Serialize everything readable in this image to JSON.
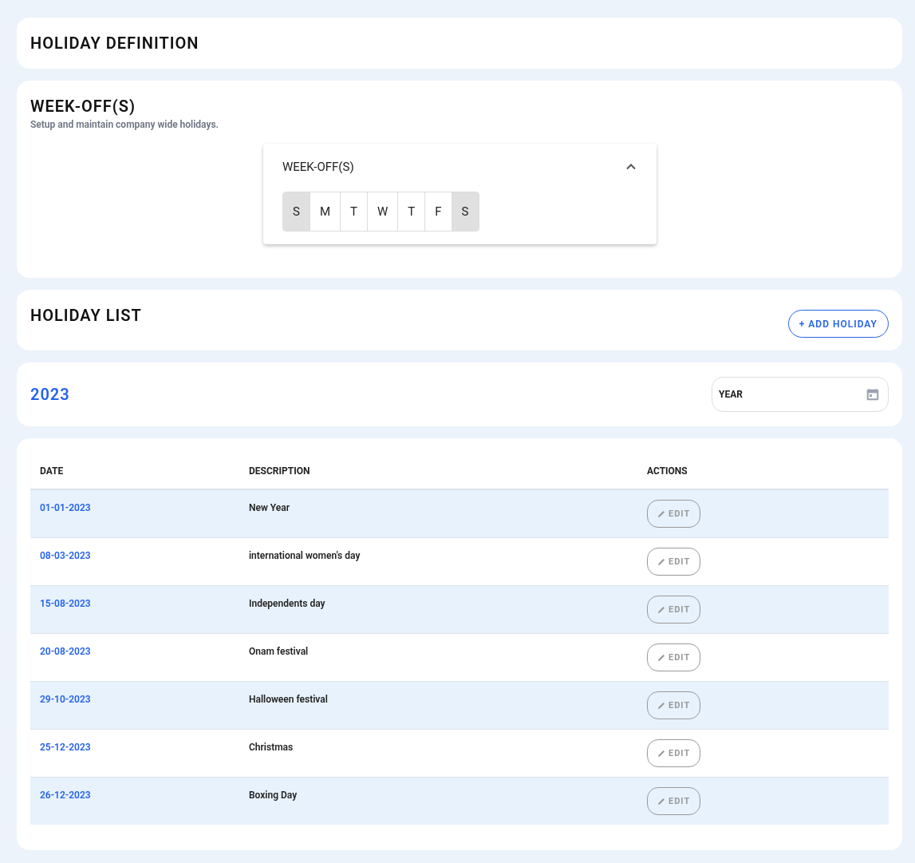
{
  "page_title": "HOLIDAY DEFINITION",
  "weekoff": {
    "title": "WEEK-OFF(S)",
    "subtitle": "Setup and maintain company wide holidays.",
    "panel": {
      "title": "WEEK-OFF(S)",
      "expanded": true,
      "days": [
        {
          "label": "S",
          "selected": true
        },
        {
          "label": "M",
          "selected": false
        },
        {
          "label": "T",
          "selected": false
        },
        {
          "label": "W",
          "selected": false
        },
        {
          "label": "T",
          "selected": false
        },
        {
          "label": "F",
          "selected": false
        },
        {
          "label": "S",
          "selected": true
        }
      ]
    }
  },
  "holiday_list": {
    "title": "HOLIDAY LIST",
    "add_button": "+ ADD HOLIDAY"
  },
  "year_bar": {
    "year": "2023",
    "year_field": {
      "placeholder": "YEAR"
    }
  },
  "table": {
    "columns": [
      "DATE",
      "DESCRIPTION",
      "ACTIONS"
    ],
    "rows": [
      {
        "date": "01-01-2023",
        "description": "New Year",
        "action": "EDIT"
      },
      {
        "date": "08-03-2023",
        "description": "international women's day",
        "action": "EDIT"
      },
      {
        "date": "15-08-2023",
        "description": "Independents day",
        "action": "EDIT"
      },
      {
        "date": "20-08-2023",
        "description": "Onam festival",
        "action": "EDIT"
      },
      {
        "date": "29-10-2023",
        "description": "Halloween festival",
        "action": "EDIT"
      },
      {
        "date": "25-12-2023",
        "description": "Christmas",
        "action": "EDIT"
      },
      {
        "date": "26-12-2023",
        "description": "Boxing Day",
        "action": "EDIT"
      }
    ]
  }
}
